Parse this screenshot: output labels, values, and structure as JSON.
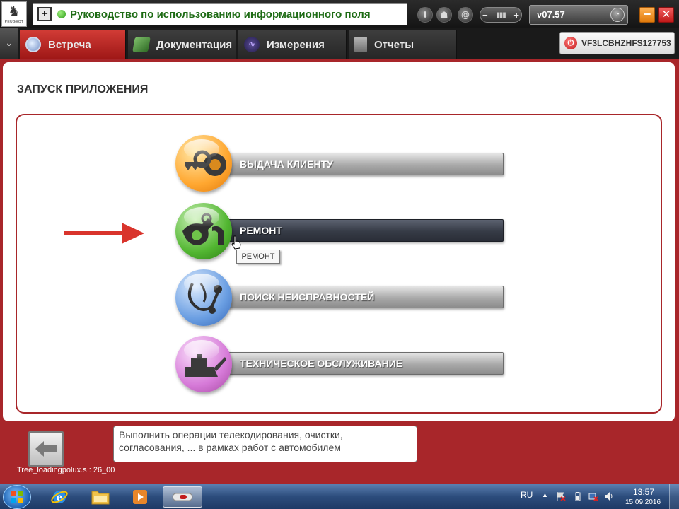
{
  "topbar": {
    "logo_brand": "PEUGEOT",
    "title": "Руководство по использованию информационного поля",
    "version": "v07.57"
  },
  "tabs": [
    {
      "label": "Встреча"
    },
    {
      "label": "Документация"
    },
    {
      "label": "Измерения"
    },
    {
      "label": "Отчеты"
    }
  ],
  "vin": "VF3LCBHZHFS127753",
  "page": {
    "title": "ЗАПУСК ПРИЛОЖЕНИЯ"
  },
  "menu": [
    {
      "label": "ВЫДАЧА КЛИЕНТУ"
    },
    {
      "label": "РЕМОНТ"
    },
    {
      "label": "ПОИСК НЕИСПРАВНОСТЕЙ"
    },
    {
      "label": "ТЕХНИЧЕСКОЕ ОБСЛУЖИВАНИЕ"
    }
  ],
  "tooltip": "РЕМОНТ",
  "info": {
    "line1": "Выполнить операции телекодирования, очистки,",
    "line2": "согласования, ... в рамках работ с автомобилем"
  },
  "status": "Tree_loadingpolux.s : 26_00",
  "taskbar": {
    "lang": "RU",
    "time": "13:57",
    "date": "15.09.2016"
  },
  "colors": {
    "brand_red": "#a8262a",
    "active_tab": "#c12a27",
    "title_green": "#1d6b14"
  }
}
